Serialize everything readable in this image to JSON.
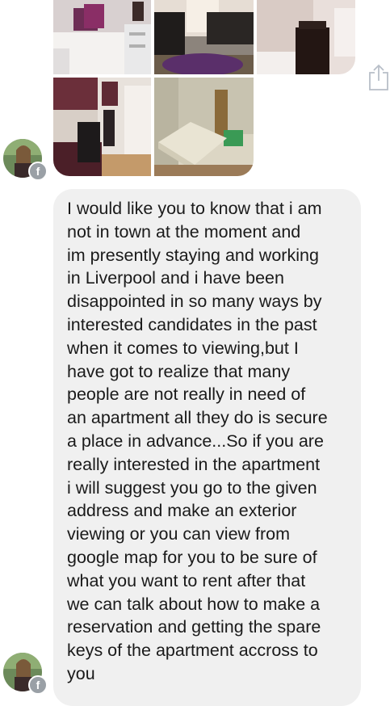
{
  "conversation": {
    "photos": [
      {
        "name": "bedroom-photo"
      },
      {
        "name": "living-room-photo"
      },
      {
        "name": "bathroom-photo"
      },
      {
        "name": "kitchen-photo"
      },
      {
        "name": "mattress-room-photo"
      }
    ],
    "message": {
      "text": "I would like you to know that i am\nnot in town  at the moment and\nim presently staying and working\nin Liverpool and i have been\ndisappointed in so many ways by\ninterested candidates in the past\nwhen it comes to viewing,but I\nhave got to realize that many\npeople are not really in need of\nan apartment all they do is secure\na place in advance...So if you are\nreally interested in the apartment\ni will suggest you go to the given\naddress and make an exterior\nviewing or you can view from\ngoogle map for you to be sure of\nwhat you want to rent after that\nwe can talk about how to make a\nreservation and getting the spare\nkeys of the apartment accross to\nyou"
    },
    "badge_glyph": "f"
  }
}
